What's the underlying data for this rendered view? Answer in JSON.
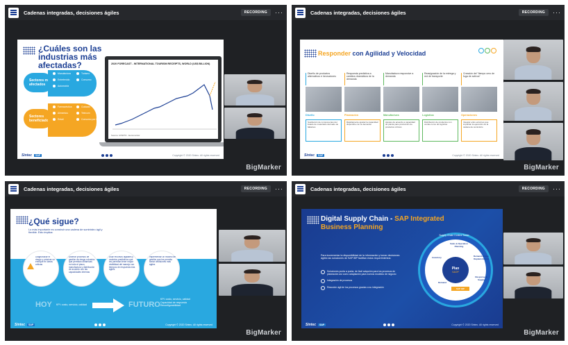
{
  "window_title": "Cadenas integradas, decisiones ágiles",
  "recording_label": "RECORDING",
  "more_label": "···",
  "brand": "BigMarker",
  "slide1": {
    "title": "¿Cuáles son las industrias más afectadas?",
    "group_affected": "Sectores más afectados",
    "group_benefited": "Sectores beneficiados",
    "affected_items": [
      "Manufactura",
      "Turismo",
      "Entretenido",
      "Consumo",
      "Automotriz"
    ],
    "benefited_items": [
      "Farmacéutica",
      "Cuidado",
      "Alimentos",
      "Telecom",
      "Retail",
      "Consumo por internet"
    ],
    "chart_title": "2020 FORECAST - INTERNATIONAL TOURISM RECEIPTS, WORLD (US$ BILLION)",
    "chart_source": "Source: UNWTO · Euromonitor",
    "footer_copyright": "Copyright © 2020 Sintec. All rights reserved",
    "logo": "Sintec",
    "sap": "SAP"
  },
  "slide2": {
    "title_orange": "Responder",
    "title_blue": "con Agilidad y Velocidad",
    "columns": [
      {
        "head": "Diseño de productos alternativos e innovadores",
        "label": "Diseño",
        "text": "Sustitución de componentes del listado de materiales derivado de faltantes"
      },
      {
        "head": "Respuesta predictiva a cambios dramáticos de la demanda",
        "label": "Planeación",
        "text": "Rápidamente ajustar la capacidad disponible con la demanda"
      },
      {
        "head": "Manufactura responsive a demanda",
        "label": "Manufactura",
        "text": "Ajustes de acuerdo a capacidad de planta para producción de productos críticos"
      },
      {
        "head": "Reasignación de la entrega y red de transporte",
        "label": "Logística",
        "text": "Distribución de productos con ventas como de logística"
      },
      {
        "head": "Creación del \"tiempo cero de fuga de activos\"",
        "label": "Operaciones",
        "text": "Integrar entre entornos que impactan la ejecución de la cadena de suministro"
      }
    ],
    "footer_copyright": "Copyright © 2020 Sintec. All rights reserved",
    "logo": "Sintec",
    "sap": "SAP"
  },
  "slide3": {
    "title": "¿Qué sigue?",
    "subtitle": "Lo más importante es construir una cadena de suministro ágil y flexible. Esto implica:",
    "circles": [
      "Diagnosticar el riesgo y priorizar un enfoque en áreas críticas",
      "Diseñar procesos de gestión de riesgo robustos que permitan dinámicas no todo el plazo, manufactura y distribución de acuerdo con las capacidades internas",
      "Usar recursos digitales y modelos predictivos que les permitan tener mayor visibilidad del manejo con tiempos de respuesta más ágiles",
      "Implementar un modelo de gestión que les permita tomar decisiones más ágiles"
    ],
    "today": "HOY",
    "today_kpi": "KPI: costo, servicio, calidad",
    "future": "FUTURO",
    "future_kpis": [
      "KPI: costo, servicio, calidad",
      "Capacidad de respuesta",
      "Reconfigurabilidad"
    ],
    "footer_copyright": "Copyright © 2020 Sintec. All rights reserved",
    "logo": "Sintec",
    "sap": "SAP"
  },
  "slide4": {
    "title_line1": "Digital Supply Chain -",
    "title_sap": "SAP Integrated",
    "title_line2": "Business Planning",
    "intro": "Para incrementar la disponibilidad de la información y tomar decisiones ágiles las soluciones de SAP IBP facilitan estos requerimientos:",
    "bullets": [
      "Soluciones punta a punta, de fácil adopción para los procesos de planeación así como adaptación para nuevos modelos de negocio",
      "Integración de procesos",
      "Reacción ágil de los procesos gracias a su integración"
    ],
    "ring_label": "Supply Chain Control Tower",
    "wheel": {
      "center": "Plan",
      "center_sub": "S&OP",
      "segments": [
        "Inventory",
        "Sales & Operation Planning",
        "Demand Driven Replenishment",
        "Response & Supply",
        "Demand",
        "SAP IBP"
      ]
    },
    "footer_copyright": "Copyright © 2020 Sintec. All rights reserved",
    "logo": "Sintec",
    "sap": "SAP"
  },
  "colors": {
    "navy": "#1c3f94",
    "orange": "#f5a623",
    "cyan": "#29a8e0",
    "green": "#5cb85c",
    "window_bg": "#1f2124"
  }
}
